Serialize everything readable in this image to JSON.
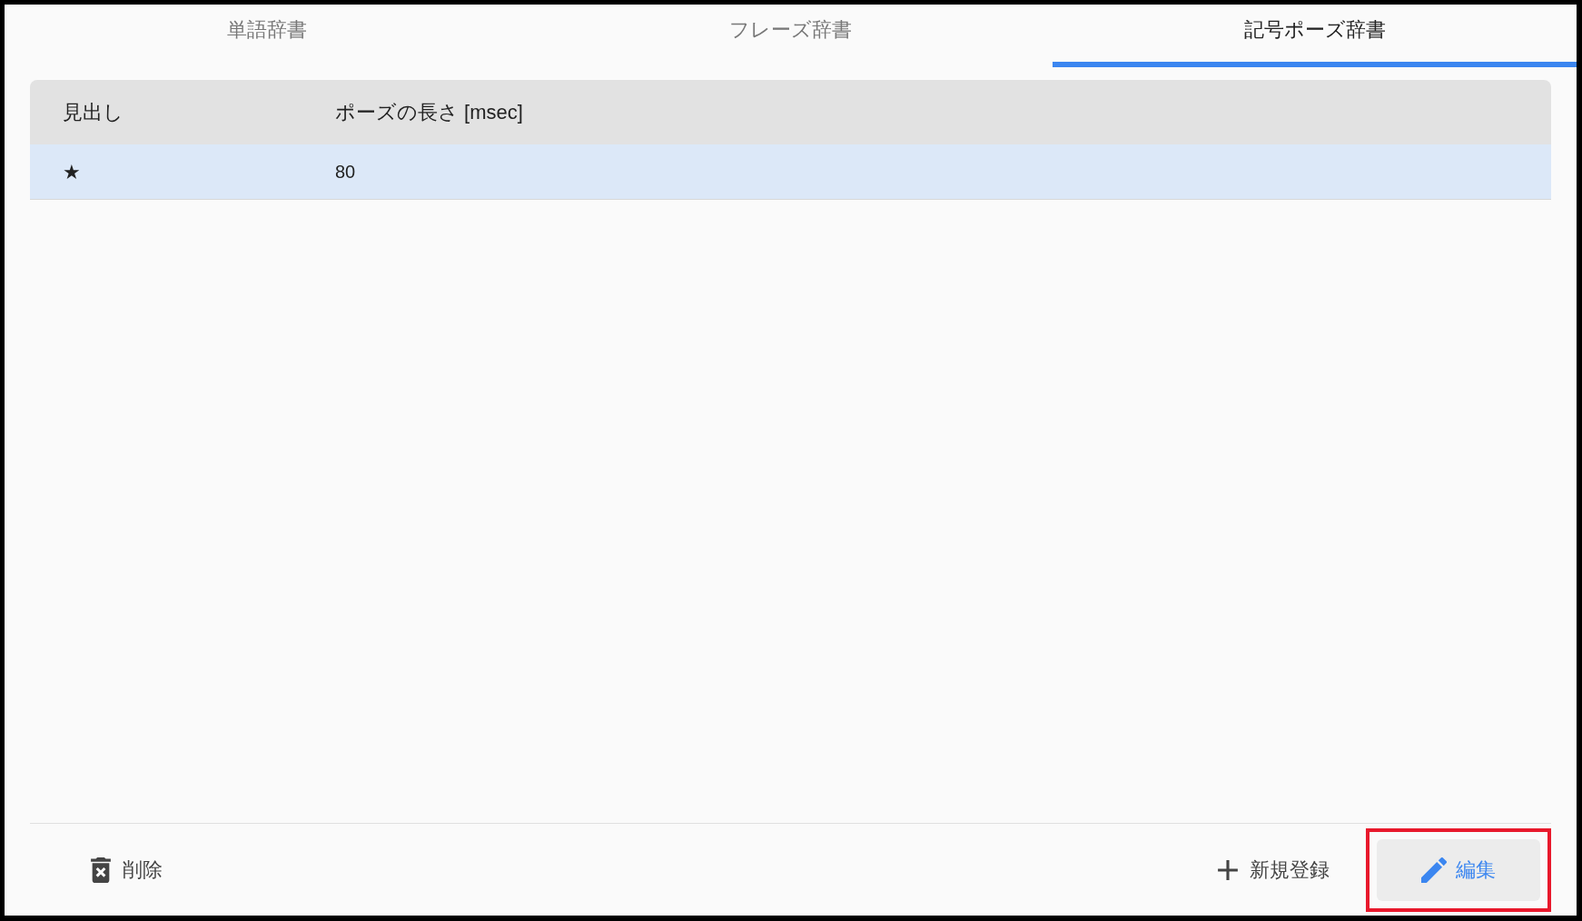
{
  "tabs": [
    {
      "label": "単語辞書",
      "selected": false
    },
    {
      "label": "フレーズ辞書",
      "selected": false
    },
    {
      "label": "記号ポーズ辞書",
      "selected": true
    }
  ],
  "table": {
    "columns": [
      "見出し",
      "ポーズの長さ [msec]"
    ],
    "rows": [
      {
        "cells": [
          "★",
          "80"
        ],
        "selected": true
      }
    ]
  },
  "actions": [
    {
      "kind": "delete",
      "label": "削除",
      "highlighted": false
    },
    {
      "kind": "add",
      "label": "新規登録",
      "highlighted": false
    },
    {
      "kind": "edit",
      "label": "編集",
      "highlighted": true
    }
  ]
}
